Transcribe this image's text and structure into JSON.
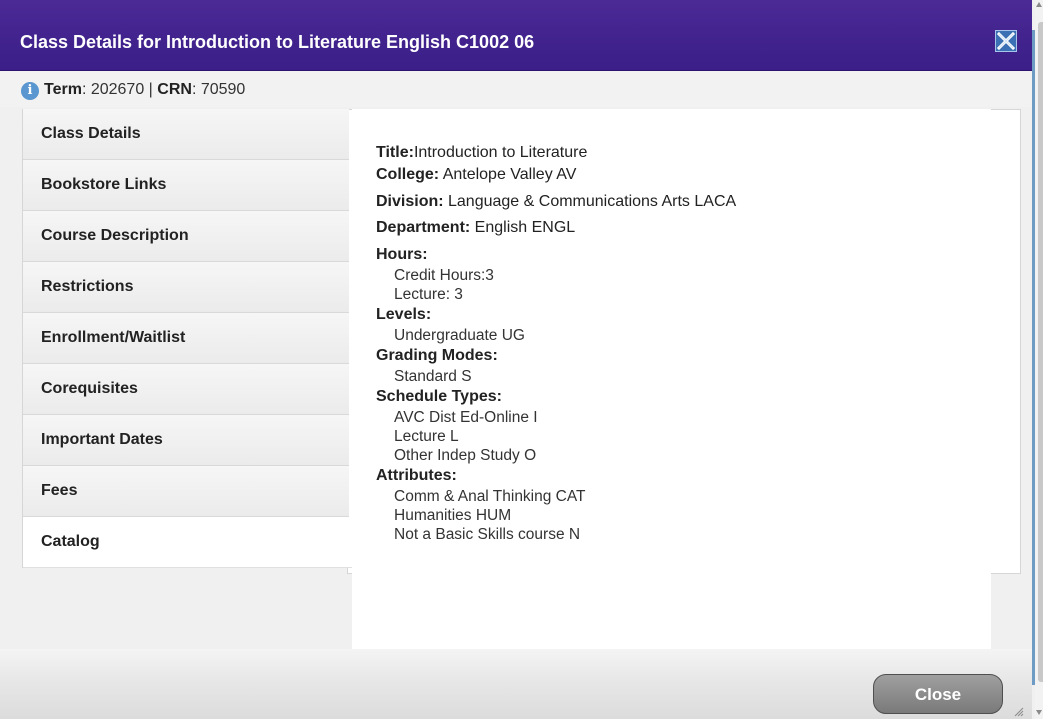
{
  "dialog": {
    "title": "Class Details for Introduction to Literature English C1002 06",
    "title_bar_color": "#3b1e88"
  },
  "info": {
    "term_label": "Term",
    "term_value": ": 202670 | ",
    "crn_label": "CRN",
    "crn_value": ": 70590"
  },
  "tabs": [
    {
      "label": "Class Details",
      "active": false
    },
    {
      "label": "Bookstore Links",
      "active": false
    },
    {
      "label": "Course Description",
      "active": false
    },
    {
      "label": "Restrictions",
      "active": false
    },
    {
      "label": "Enrollment/Waitlist",
      "active": false
    },
    {
      "label": "Corequisites",
      "active": false
    },
    {
      "label": "Important Dates",
      "active": false
    },
    {
      "label": "Fees",
      "active": false
    },
    {
      "label": "Catalog",
      "active": true
    }
  ],
  "catalog": {
    "title_label": "Title:",
    "title_value": "Introduction to Literature",
    "college_label": "College:",
    "college_value": " Antelope Valley AV",
    "division_label": "Division:",
    "division_value": " Language & Communications Arts LACA",
    "department_label": "Department:",
    "department_value": " English ENGL",
    "hours_label": "Hours:",
    "hours": [
      "Credit Hours:3",
      "Lecture: 3"
    ],
    "levels_label": "Levels:",
    "levels": [
      "Undergraduate UG"
    ],
    "grading_label": "Grading Modes:",
    "grading": [
      "Standard S"
    ],
    "schedule_label": "Schedule Types:",
    "schedule": [
      "AVC Dist Ed-Online I",
      "Lecture L",
      "Other Indep Study O"
    ],
    "attributes_label": "Attributes:",
    "attributes": [
      "Comm & Anal Thinking CAT",
      "Humanities HUM",
      "Not a Basic Skills course N"
    ]
  },
  "footer": {
    "close_label": "Close"
  },
  "icons": {
    "info": "info-icon",
    "close": "close-icon",
    "resize": "resize-grip-icon"
  }
}
